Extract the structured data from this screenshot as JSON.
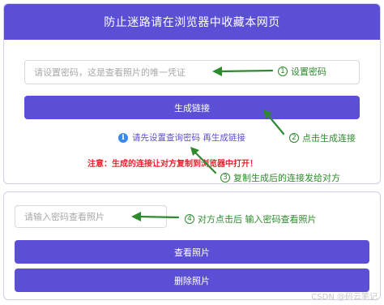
{
  "header": {
    "title": "防止迷路请在浏览器中收藏本网页"
  },
  "top_form": {
    "password_placeholder": "请设置密码，这是查看照片的唯一凭证",
    "generate_button": "生成链接",
    "hint_text": "请先设置查询密码 再生成链接",
    "warning_text": "注意：生成的连接让对方复制到浏览器中打开！"
  },
  "bottom_form": {
    "password_placeholder": "请输入密码查看照片",
    "view_button": "查看照片",
    "delete_button": "删除照片"
  },
  "annotations": {
    "a1": {
      "num": "1",
      "text": "设置密码"
    },
    "a2": {
      "num": "2",
      "text": "点击生成连接"
    },
    "a3": {
      "num": "3",
      "text": "复制生成后的连接发给对方"
    },
    "a4": {
      "num": "4",
      "text": "对方点击后 输入密码查看照片"
    }
  },
  "watermark": "CSDN @码云笔记",
  "colors": {
    "accent": "#5b4fd6",
    "annotation_green": "#2f8a2f",
    "warning_red": "#e8232e",
    "info_blue": "#3a8be8"
  }
}
